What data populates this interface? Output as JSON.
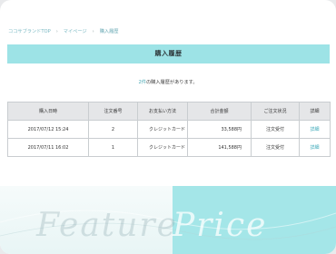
{
  "breadcrumb": {
    "home": "ココサブランドTOP",
    "separator": "›",
    "mypage": "マイページ",
    "current": "購入履歴"
  },
  "page_title": "購入履歴",
  "summary": {
    "count": "2件",
    "text": "の購入履歴があります。"
  },
  "table": {
    "headers": [
      "購入日時",
      "注文番号",
      "お支払い方法",
      "合計金額",
      "ご注文状況",
      "詳細"
    ],
    "rows": [
      {
        "date": "2017/07/12 15:24",
        "order_no": "2",
        "payment": "クレジットカード",
        "total": "33,588円",
        "status": "注文受付",
        "detail": "詳細"
      },
      {
        "date": "2017/07/11 16:02",
        "order_no": "1",
        "payment": "クレジットカード",
        "total": "141,588円",
        "status": "注文受付",
        "detail": "詳細"
      }
    ]
  },
  "footer_deco": {
    "left": "Feature",
    "right": "Price"
  },
  "colors": {
    "accent": "#9de3e6",
    "link": "#3aa8b8"
  }
}
